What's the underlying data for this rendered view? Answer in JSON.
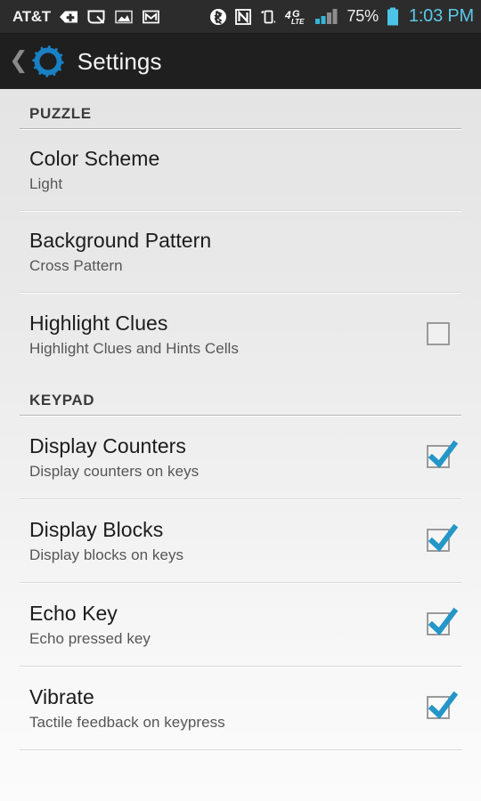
{
  "statusbar": {
    "carrier": "AT&T",
    "left_icons": [
      {
        "name": "medical-plus-tag-icon"
      },
      {
        "name": "screenshot-capture-icon"
      },
      {
        "name": "gallery-image-icon"
      },
      {
        "name": "gmail-icon"
      }
    ],
    "right_icons": [
      {
        "name": "bluetooth-icon"
      },
      {
        "name": "nfc-icon"
      },
      {
        "name": "vibrate-mode-icon"
      },
      {
        "name": "network-4g-lte-icon"
      },
      {
        "name": "signal-bars-icon"
      }
    ],
    "battery_percent": "75%",
    "battery_icon": "battery-full-icon",
    "clock": "1:03 PM",
    "clock_color": "#5ec8e8",
    "battery_color": "#4dc3e8",
    "signal_active_color": "#36b4d6",
    "signal_inactive_color": "#8d8d8d"
  },
  "actionbar": {
    "back_icon": "back-chevron-icon",
    "app_icon": "settings-gear-icon",
    "app_icon_color": "#1a80c4",
    "title": "Settings"
  },
  "sections": [
    {
      "header": "PUZZLE",
      "rows": [
        {
          "title": "Color Scheme",
          "summary": "Light",
          "control": "none",
          "checked": false
        },
        {
          "title": "Background Pattern",
          "summary": "Cross Pattern",
          "control": "none",
          "checked": false
        },
        {
          "title": "Highlight Clues",
          "summary": "Highlight Clues and Hints Cells",
          "control": "checkbox",
          "checked": false
        }
      ]
    },
    {
      "header": "KEYPAD",
      "rows": [
        {
          "title": "Display Counters",
          "summary": "Display counters on keys",
          "control": "checkbox",
          "checked": true
        },
        {
          "title": "Display Blocks",
          "summary": "Display blocks on keys",
          "control": "checkbox",
          "checked": true
        },
        {
          "title": "Echo Key",
          "summary": "Echo pressed key",
          "control": "checkbox",
          "checked": true
        },
        {
          "title": "Vibrate",
          "summary": "Tactile feedback on keypress",
          "control": "checkbox",
          "checked": true
        }
      ]
    }
  ],
  "theme": {
    "checkbox_tick_color": "#2496c8",
    "checkbox_border_color": "#9a9a9a",
    "statusbar_bg": "#2c2c2c",
    "actionbar_bg": "#1f1f1f"
  }
}
